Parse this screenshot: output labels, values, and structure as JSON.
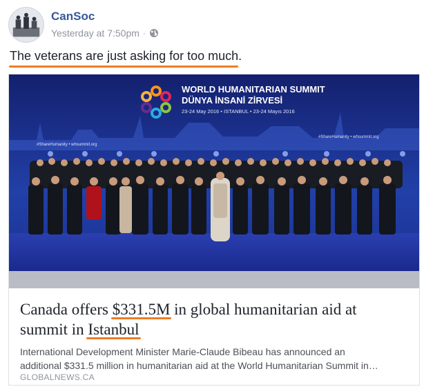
{
  "post": {
    "page_name": "CanSoc",
    "timestamp": "Yesterday at 7:50pm",
    "separator": "·",
    "privacy_icon": "globe-icon",
    "status_text": "The veterans are just asking for too much."
  },
  "link": {
    "title_part1": "Canada offers ",
    "title_amount": "$331.5M",
    "title_part2": " in global humanitarian aid at summit in ",
    "title_city": "Istanbul",
    "description_line1": "International Development Minister Marie-Claude Bibeau has announced an",
    "description_line2": "additional $331.5 million in humanitarian aid at the World Humanitarian Summit in…",
    "domain": "GLOBALNEWS.CA"
  },
  "photo": {
    "banner_title_line1": "WORLD HUMANITARIAN SUMMIT",
    "banner_title_line2": "DÜNYA İNSANİ ZİRVESİ",
    "banner_dates": "23-24 May 2016 • ISTANBUL • 23-24 Mayıs 2016",
    "hashtag_left": "#ShareHumanity • whsummit.org",
    "hashtag_right": "#ShareHumanity • whsummit.org"
  },
  "colors": {
    "accent_underline": "#f07b22",
    "page_name": "#365899",
    "banner_blue": "#1b2a88"
  }
}
